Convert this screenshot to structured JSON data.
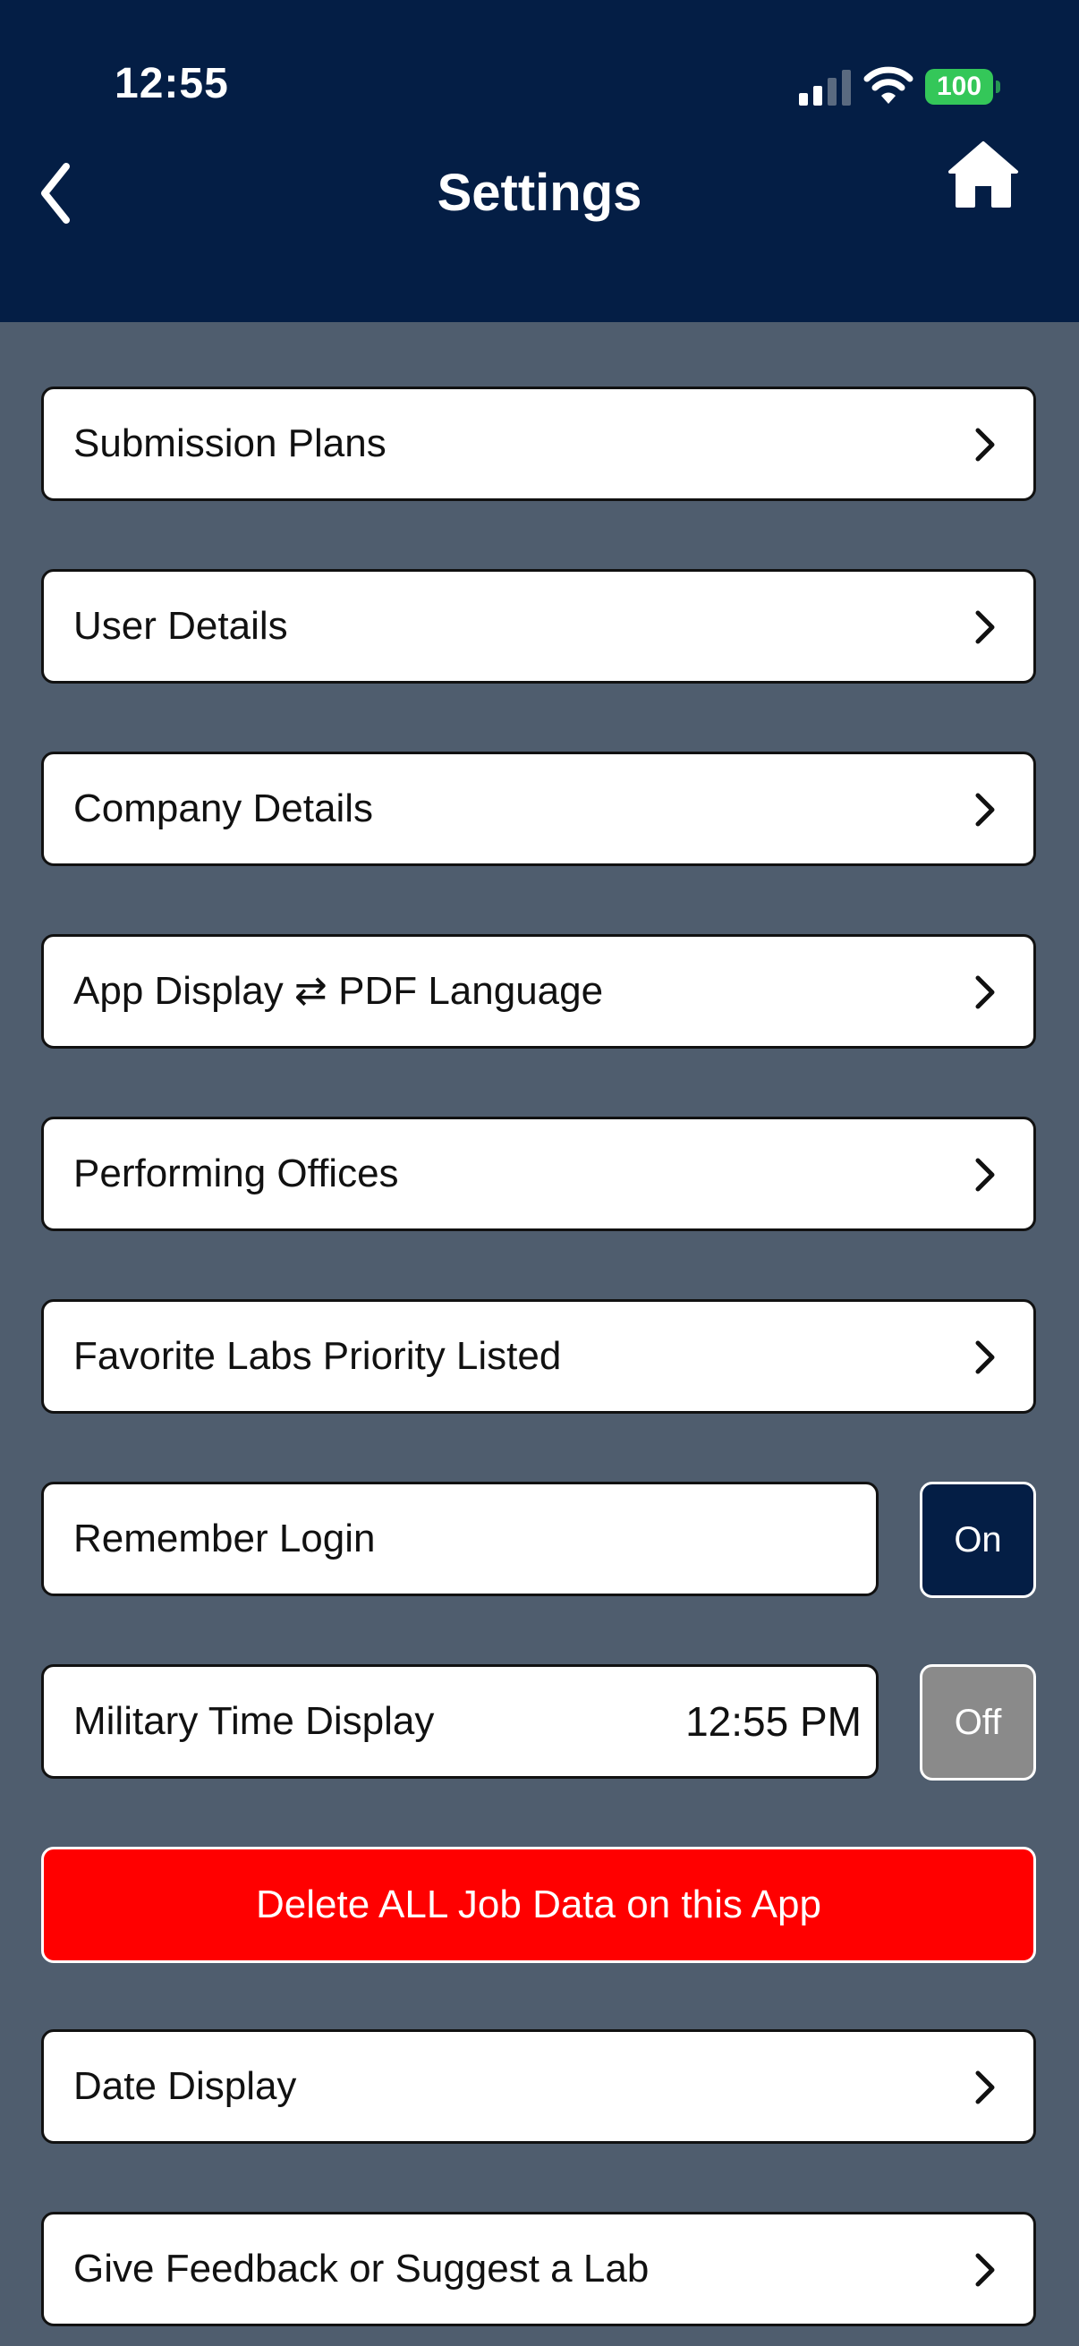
{
  "status_bar": {
    "time": "12:55",
    "battery": "100",
    "icons": [
      "signal-icon",
      "wifi-icon",
      "battery-icon"
    ]
  },
  "header": {
    "title": "Settings",
    "back_icon": "chevron-left-icon",
    "home_icon": "home-icon"
  },
  "colors": {
    "header_bg": "#041e45",
    "page_bg": "#4f5d6e",
    "danger": "#ff0000",
    "toggle_on": "#041e45",
    "toggle_off": "#8a8a8a",
    "battery": "#34c759"
  },
  "menu": [
    {
      "label": "Submission Plans"
    },
    {
      "label": "User Details"
    },
    {
      "label": "Company Details"
    },
    {
      "label": "App Display ⇄ PDF Language"
    },
    {
      "label": "Performing Offices"
    },
    {
      "label": "Favorite Labs Priority Listed"
    }
  ],
  "toggles": {
    "remember_login": {
      "label": "Remember Login",
      "state": "On"
    },
    "military_time": {
      "label": "Military Time Display",
      "preview": "12:55 PM",
      "state": "Off"
    }
  },
  "danger_button": {
    "label": "Delete ALL Job Data on this App"
  },
  "menu_bottom": [
    {
      "label": "Date Display"
    },
    {
      "label": "Give Feedback or Suggest a Lab"
    }
  ]
}
